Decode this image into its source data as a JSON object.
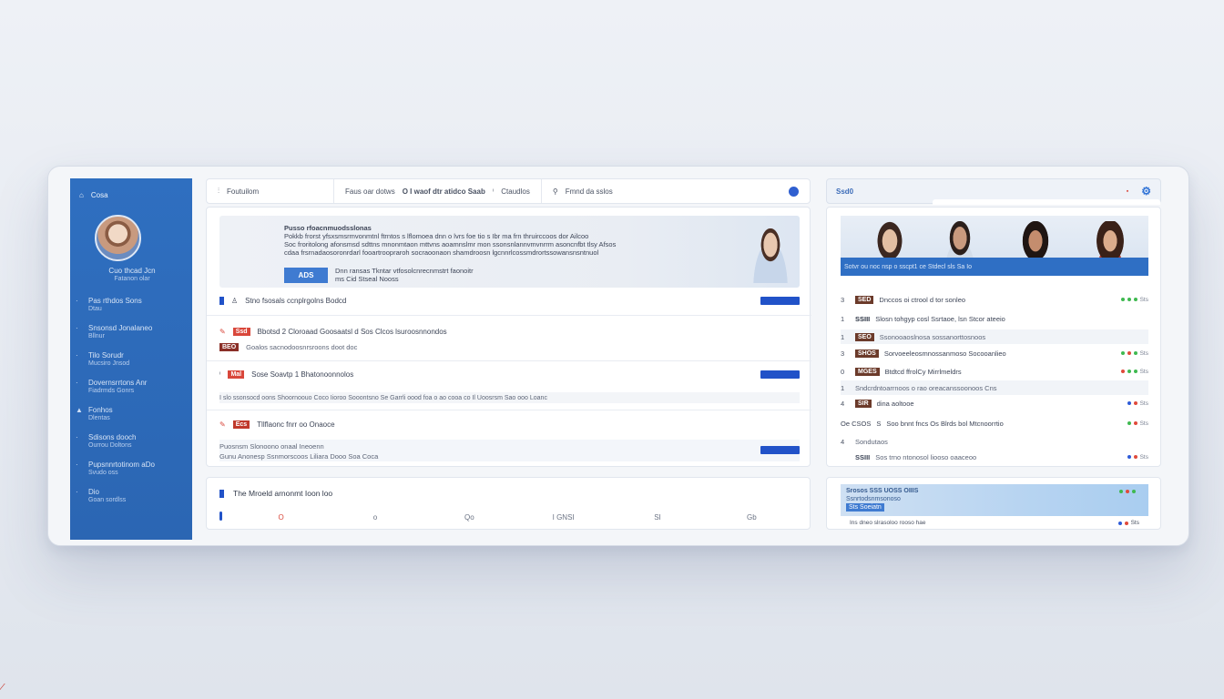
{
  "sidebar": {
    "header": "Cosa",
    "user_name": "Cuo thcad Jcn",
    "user_sub": "Fatanon olar",
    "items": [
      {
        "label": "Pas rthdos Sons",
        "sub": "Dtau"
      },
      {
        "label": "Snsonsd Jonalaneo",
        "sub": "Bllnur"
      },
      {
        "label": "Tilo Sorudr",
        "sub": "Mucsiro Jnsod"
      },
      {
        "label": "Dovernsrrtons Anr",
        "sub": "Fiadrmds Gonrs"
      },
      {
        "label": "Fonhos",
        "sub": "Dlentas"
      },
      {
        "label": "Sdisons dooch",
        "sub": "Ourrou Doltons"
      },
      {
        "label": "Pupsnnrtotinom aDo",
        "sub": "Svudo oss"
      },
      {
        "label": "Dio",
        "sub": "Goan sordlss"
      }
    ]
  },
  "topbar": {
    "tab1": "Foutuilom",
    "tab2": "Faus oar dotws",
    "tab3": "O I waof dtr atidco Saab",
    "tab4": "Ctaudlos",
    "tab5": "Fmnd da sslos"
  },
  "hero": {
    "heading": "Pusso rfoacnmuodsslonas",
    "line1": "Pokkb frorst yfsxsmsrmvonmtnl ftrntos s lflomoea dnn o lvrs foe tio s Ibr ma frn thruirccoos dor Ailcoo",
    "line2": "Soc froritolong afonsmsd sdttns mnonmtaon mttvns aoamnslmr mon ssonsnlannvmvnrrm asoncnfbt tlsy Afsos",
    "line3": "cdaa frsrnadaosoronrdarl fooartroopraroh socraoonaon shamdroosn lgcnnrlcossmdrortssowansnsntnuol",
    "badge": "ADS",
    "cta_line1": "Dnn ransas Tkntar vtfosolcnrecnmstrt faonoitr",
    "cta_line2": "ms Cid Stseal Nooss"
  },
  "sections": {
    "s1_label": "Stno fsosals ccnplrgolns Bodcd",
    "s2_tag": "Ssd",
    "s2_label": "Bbotsd 2 Cloroaad Goosaatsl d Sos Clcos lsuroosnnondos",
    "s2_sub_tag": "BEO",
    "s2_sub": "Goalos sacnodoosnrsroons doot doc",
    "s3_tag": "Mal",
    "s3_label": "Sose Soavtp 1 Bhatonoonnolos",
    "s3_detail": "I slo ssonsocd oons Shoornoouo Coco Iioroo Sooontsno Se Garrli oood foa o ao cooa co Il Uoosrsm Sao ooo Loanc",
    "s4_tag": "Ecs",
    "s4_label": "Tllflaonc fnrr oo Onaoce",
    "s4_sub_a": "Puosnsm Slonoono onaal Ineoenn",
    "s4_sub_b": "Gunu Anonesp Ssnmorscoos Liliara Dooo Soa Coca"
  },
  "bottom_card": {
    "title": "The Mroeld arnonmt Ioon loo",
    "cols": [
      "",
      "O",
      "o",
      "Qo",
      "I GNSI",
      "SI",
      "Gb"
    ]
  },
  "right_panel": {
    "header": "Ssd0",
    "people_caption": "Sotvr ou noc nsp o sscpt1 ce Stdecl sls Sa Io",
    "rows": [
      {
        "num": "3",
        "tag": "SED",
        "text": "Dnccos oi ctrool d tor sonleo",
        "status": "Sts"
      },
      {
        "num": "1",
        "tag": "SSIII",
        "text": "Slosn tohgyp cosl Ssrtaoe, lsn Stcor ateeio",
        "status": ""
      },
      {
        "num": "1",
        "tag": "SEO",
        "text": "Ssonooaoslnosa sossanorttosnoos",
        "status": ""
      },
      {
        "num": "3",
        "tag": "SHOS",
        "text": "Sorvoeeleosmnossanmoso Socooanlieo",
        "status": "Sts"
      },
      {
        "num": "0",
        "tag": "MGES",
        "text": "Btdtcd ffrolCy Mirrlmeldrs",
        "status": "Sts"
      },
      {
        "num": "1",
        "tag": "",
        "text": "Sndcrdntoarrnoos o rao oreacanssoonoos Cns",
        "status": ""
      },
      {
        "num": "4",
        "tag": "SIR",
        "text": "dina aoltooe",
        "status": "Sts"
      },
      {
        "num": "Oe CSOS",
        "tag": "S",
        "text": "Soo bnnt fncs Os Blrds bol Mtcnoorrtio",
        "status": "Sts"
      },
      {
        "num": "4",
        "tag": "",
        "text": "Sondutaos",
        "status": ""
      },
      {
        "num": "",
        "tag": "SSIII",
        "text": "Sos trno ntonosol liooso oaaceoo",
        "status": "Sts"
      }
    ],
    "banner_l1": "Srosos SSS UOSS OIIIS",
    "banner_l2": "Ssnrtodsnmsonoso",
    "banner_l3": "Sts Soeiatn",
    "footer_text": "Ins dneo slrasoloo rooso hae",
    "footer_status": "Sts"
  },
  "colors": {
    "sidebar": "#2f6fc0",
    "accent": "#2152c8",
    "status_green": "#3fb950",
    "status_red": "#e04a3b",
    "status_blue": "#2e5bd8"
  }
}
